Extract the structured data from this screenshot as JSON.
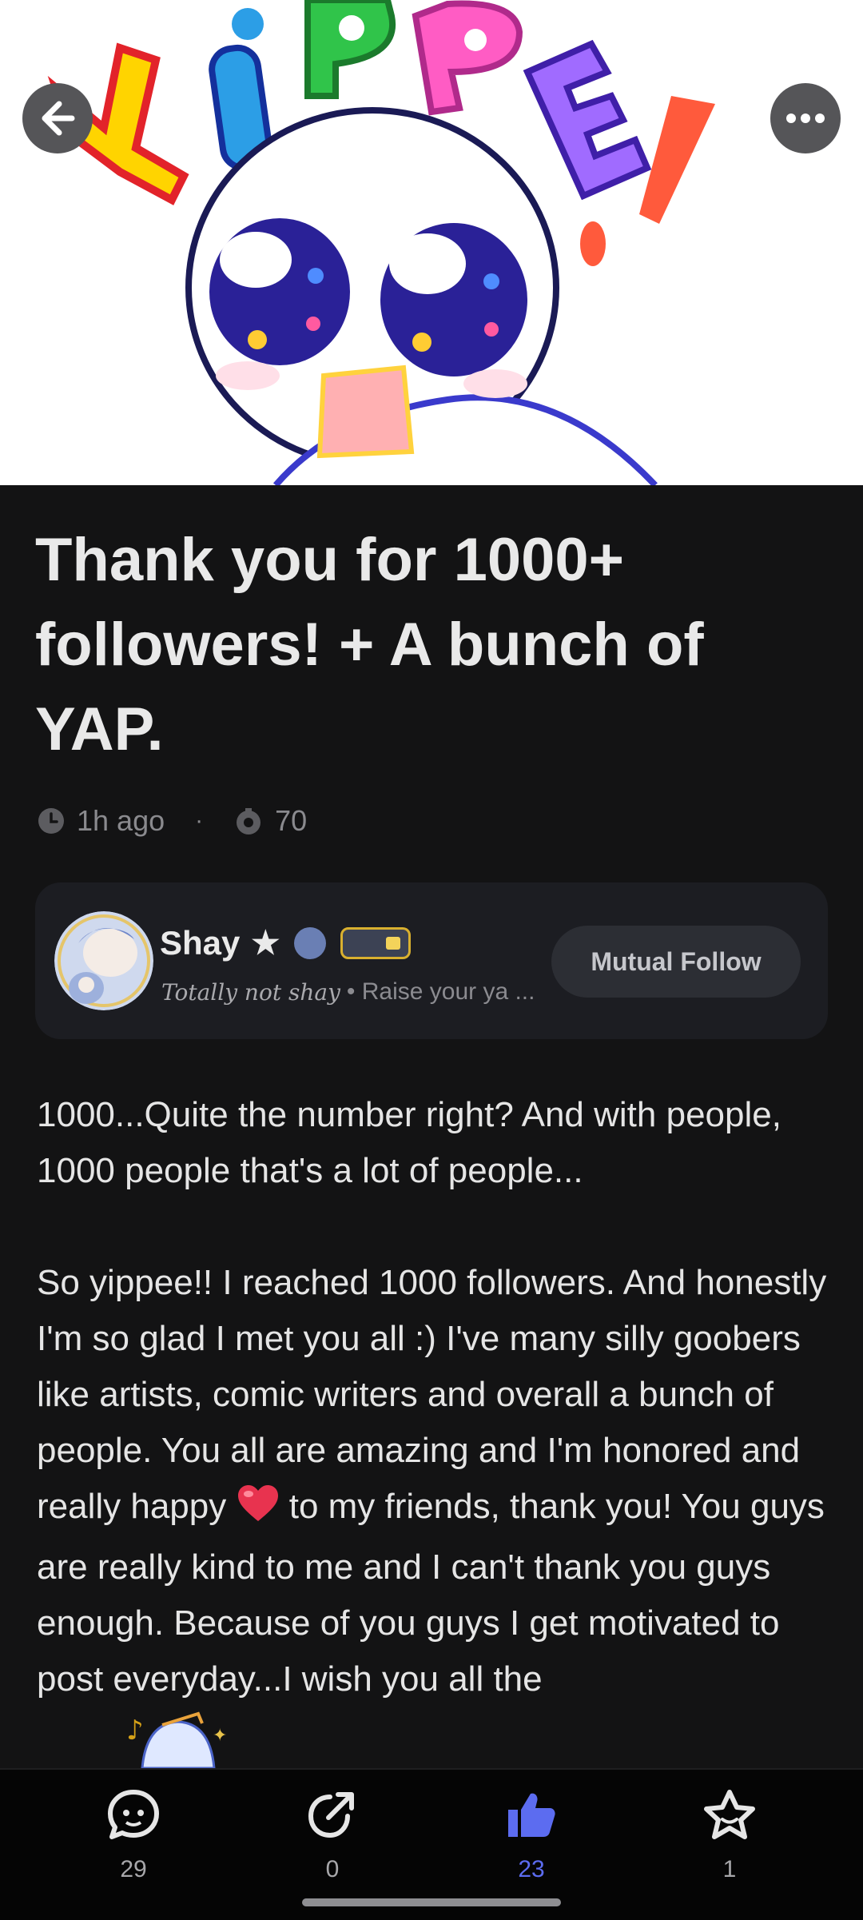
{
  "hero": {
    "sticker_text": "YiPPE!"
  },
  "nav": {
    "back_icon": "arrow-left-icon",
    "more_icon": "more-dots-icon"
  },
  "post": {
    "title": "Thank you for 1000+ followers! + A bunch of YAP.",
    "time_ago": "1h ago",
    "views": "70",
    "paragraphs": [
      "1000...Quite the number right? And with people, 1000 people that's a lot of people...",
      "So yippee!! I reached 1000 followers. And honestly I'm so glad I met you all :) I've many silly goobers like artists, comic writers and overall a bunch of people. You all are amazing and I'm honored and really happy"
    ],
    "paragraph_tail": " to my friends, thank you! You guys are really kind to me and I can't thank you guys enough. Because of you guys I get motivated to post everyday...I wish you all the"
  },
  "author": {
    "name": "Shay",
    "name_star": "★",
    "flair": "Totally not shay",
    "bio": "• Raise your ya ...",
    "follow_label": "Mutual Follow"
  },
  "toolbar": {
    "comments": "29",
    "shares": "0",
    "likes": "23",
    "favorites": "1"
  },
  "colors": {
    "background": "#131314",
    "accent": "#5c6cf0",
    "card": "#1c1d22"
  }
}
